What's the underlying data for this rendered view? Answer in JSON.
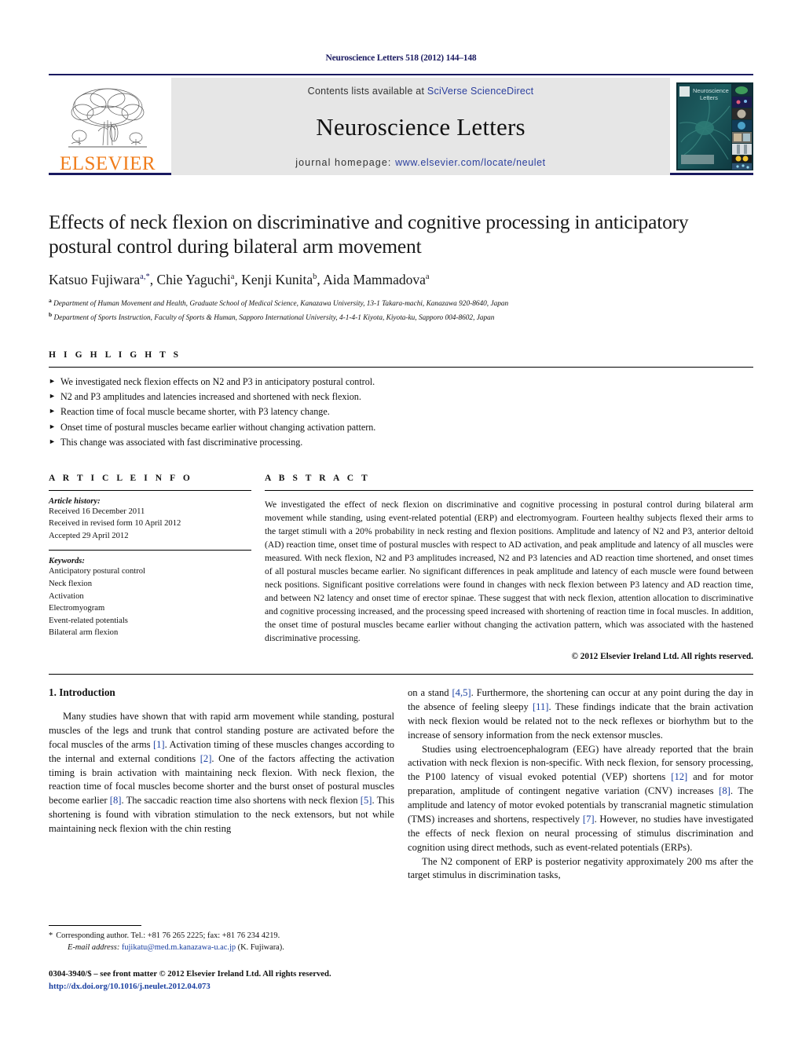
{
  "running_head": "Neuroscience Letters 518 (2012) 144–148",
  "masthead": {
    "contents_prefix": "Contents lists available at ",
    "contents_link": "SciVerse ScienceDirect",
    "journal_title": "Neuroscience Letters",
    "homepage_prefix": "journal homepage: ",
    "homepage_url": "www.elsevier.com/locate/neulet",
    "publisher": "ELSEVIER",
    "cover_title_line1": "Neuroscience",
    "cover_title_line2": "Letters",
    "accent_orange": "#f07c1a",
    "link_blue": "#2b3f9e",
    "rule_navy": "#1a1a60"
  },
  "article": {
    "title": "Effects of neck flexion on discriminative and cognitive processing in anticipatory postural control during bilateral arm movement",
    "authors": [
      {
        "name": "Katsuo Fujiwara",
        "sup": "a,*"
      },
      {
        "name": "Chie Yaguchi",
        "sup": "a"
      },
      {
        "name": "Kenji Kunita",
        "sup": "b"
      },
      {
        "name": "Aida Mammadova",
        "sup": "a"
      }
    ],
    "affiliations": [
      {
        "mark": "a",
        "text": "Department of Human Movement and Health, Graduate School of Medical Science, Kanazawa University, 13-1 Takara-machi, Kanazawa 920-8640, Japan"
      },
      {
        "mark": "b",
        "text": "Department of Sports Instruction, Faculty of Sports & Human, Sapporo International University, 4-1-4-1 Kiyota, Kiyota-ku, Sapporo 004-8602, Japan"
      }
    ]
  },
  "highlights": {
    "label": "H I G H L I G H T S",
    "bullet": "►",
    "items": [
      "We investigated neck flexion effects on N2 and P3 in anticipatory postural control.",
      "N2 and P3 amplitudes and latencies increased and shortened with neck flexion.",
      "Reaction time of focal muscle became shorter, with P3 latency change.",
      "Onset time of postural muscles became earlier without changing activation pattern.",
      "This change was associated with fast discriminative processing."
    ]
  },
  "article_info": {
    "label": "A R T I C L E    I N F O",
    "history_label": "Article history:",
    "history": [
      "Received 16 December 2011",
      "Received in revised form 10 April 2012",
      "Accepted 29 April 2012"
    ],
    "keywords_label": "Keywords:",
    "keywords": [
      "Anticipatory postural control",
      "Neck flexion",
      "Activation",
      "Electromyogram",
      "Event-related potentials",
      "Bilateral arm flexion"
    ]
  },
  "abstract": {
    "label": "A B S T R A C T",
    "text": "We investigated the effect of neck flexion on discriminative and cognitive processing in postural control during bilateral arm movement while standing, using event-related potential (ERP) and electromyogram. Fourteen healthy subjects flexed their arms to the target stimuli with a 20% probability in neck resting and flexion positions. Amplitude and latency of N2 and P3, anterior deltoid (AD) reaction time, onset time of postural muscles with respect to AD activation, and peak amplitude and latency of all muscles were measured. With neck flexion, N2 and P3 amplitudes increased, N2 and P3 latencies and AD reaction time shortened, and onset times of all postural muscles became earlier. No significant differences in peak amplitude and latency of each muscle were found between neck positions. Significant positive correlations were found in changes with neck flexion between P3 latency and AD reaction time, and between N2 latency and onset time of erector spinae. These suggest that with neck flexion, attention allocation to discriminative and cognitive processing increased, and the processing speed increased with shortening of reaction time in focal muscles. In addition, the onset time of postural muscles became earlier without changing the activation pattern, which was associated with the hastened discriminative processing.",
    "copyright": "© 2012 Elsevier Ireland Ltd. All rights reserved."
  },
  "body": {
    "section_heading": "1.  Introduction",
    "left_paragraph_1_parts": [
      {
        "t": "Many studies have shown that with rapid arm movement while standing, postural muscles of the legs and trunk that control standing posture are activated before the focal muscles of the arms "
      },
      {
        "t": "[1]",
        "ref": true
      },
      {
        "t": ". Activation timing of these muscles changes according to the internal and external conditions "
      },
      {
        "t": "[2]",
        "ref": true
      },
      {
        "t": ". One of the factors affecting the activation timing is brain activation with maintaining neck flexion. With neck flexion, the reaction time of focal muscles become shorter and the burst onset of postural muscles become earlier "
      },
      {
        "t": "[8]",
        "ref": true
      },
      {
        "t": ". The saccadic reaction time also shortens with neck flexion "
      },
      {
        "t": "[5]",
        "ref": true
      },
      {
        "t": ". This shortening is found with vibration stimulation to the neck extensors, but not while maintaining neck flexion with the chin resting"
      }
    ],
    "right_paragraph_1_parts": [
      {
        "t": "on a stand "
      },
      {
        "t": "[4,5]",
        "ref": true
      },
      {
        "t": ". Furthermore, the shortening can occur at any point during the day in the absence of feeling sleepy "
      },
      {
        "t": "[11]",
        "ref": true
      },
      {
        "t": ". These findings indicate that the brain activation with neck flexion would be related not to the neck reflexes or biorhythm but to the increase of sensory information from the neck extensor muscles."
      }
    ],
    "right_paragraph_2_parts": [
      {
        "t": "Studies using electroencephalogram (EEG) have already reported that the brain activation with neck flexion is non-specific. With neck flexion, for sensory processing, the P100 latency of visual evoked potential (VEP) shortens "
      },
      {
        "t": "[12]",
        "ref": true
      },
      {
        "t": " and for motor preparation, amplitude of contingent negative variation (CNV) increases "
      },
      {
        "t": "[8]",
        "ref": true
      },
      {
        "t": ". The amplitude and latency of motor evoked potentials by transcranial magnetic stimulation (TMS) increases and shortens, respectively "
      },
      {
        "t": "[7]",
        "ref": true
      },
      {
        "t": ". However, no studies have investigated the effects of neck flexion on neural processing of stimulus discrimination and cognition using direct methods, such as event-related potentials (ERPs)."
      }
    ],
    "right_paragraph_3_parts": [
      {
        "t": "The N2 component of ERP is posterior negativity approximately 200 ms after the target stimulus in discrimination tasks,"
      }
    ]
  },
  "footer": {
    "corresponding_star": "*",
    "corresponding_text": "Corresponding author. Tel.: +81 76 265 2225; fax: +81 76 234 4219.",
    "email_label": "E-mail address:",
    "email": "fujikatu@med.m.kanazawa-u.ac.jp",
    "email_suffix": "(K. Fujiwara).",
    "issn_line": "0304-3940/$ – see front matter © 2012 Elsevier Ireland Ltd. All rights reserved.",
    "doi_line": "http://dx.doi.org/10.1016/j.neulet.2012.04.073"
  }
}
